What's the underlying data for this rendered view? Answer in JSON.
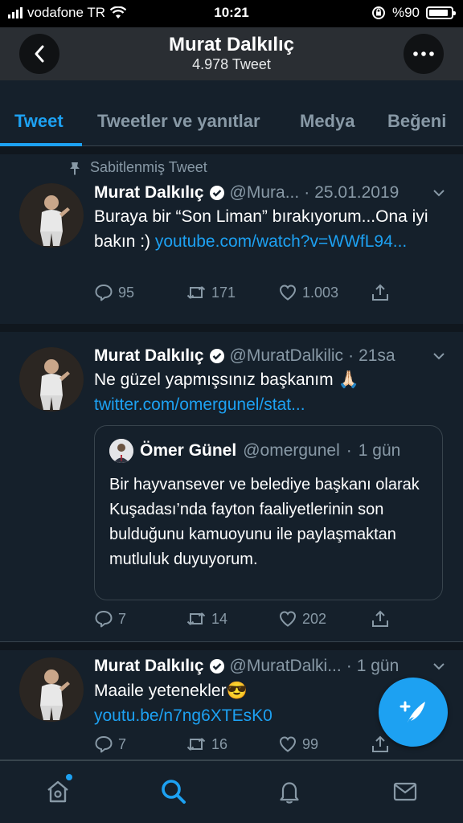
{
  "status_bar": {
    "carrier": "vodafone TR",
    "time": "10:21",
    "battery": "%90",
    "battery_level": 0.9
  },
  "header": {
    "name": "Murat Dalkılıç",
    "tweet_count": "4.978 Tweet"
  },
  "tabs": [
    {
      "label": "Tweet",
      "active": true
    },
    {
      "label": "Tweetler ve yanıtlar",
      "active": false
    },
    {
      "label": "Medya",
      "active": false
    },
    {
      "label": "Beğeni",
      "active": false
    }
  ],
  "tweets": [
    {
      "pinned_label": "Sabitlenmiş Tweet",
      "name": "Murat Dalkılıç",
      "handle": "@Mura...",
      "time": "25.01.2019",
      "text": "Buraya bir “Son Liman” bırakıyorum...Ona iyi bakın :) ",
      "link": "youtube.com/watch?v=WWfL94...",
      "replies": "95",
      "retweets": "171",
      "likes": "1.003"
    },
    {
      "name": "Murat Dalkılıç",
      "handle": "@MuratDalkilic",
      "time": "21sa",
      "text": "Ne güzel yapmışsınız başkanım 🙏🏻",
      "link": "twitter.com/omergunel/stat...",
      "quote": {
        "name": "Ömer Günel",
        "handle": "@omergunel",
        "time": "1 gün",
        "text": "Bir hayvansever ve belediye başkanı olarak Kuşadası’nda fayton faaliyetlerinin son bulduğunu kamuoyunu ile paylaşmaktan mutluluk duyuyorum."
      },
      "replies": "7",
      "retweets": "14",
      "likes": "202"
    },
    {
      "name": "Murat Dalkılıç",
      "handle": "@MuratDalki...",
      "time": "1 gün",
      "text": "Maaile yetenekler😎 ",
      "link": "youtu.be/n7ng6XTEsK0",
      "replies": "7",
      "retweets": "16",
      "likes": "99"
    }
  ],
  "colors": {
    "accent": "#1da1f2",
    "background": "#15202b",
    "muted": "#8899a6",
    "border": "#38444d"
  }
}
